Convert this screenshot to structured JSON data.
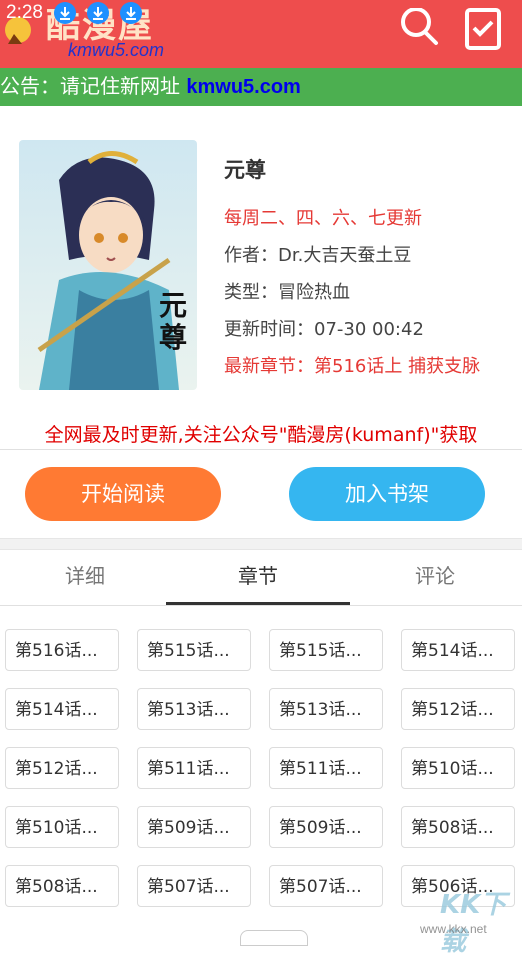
{
  "status": {
    "time": "2:28",
    "notifications": [
      "download-icon",
      "download-icon",
      "download-icon"
    ]
  },
  "header": {
    "logo_text": "酷漫屋",
    "logo_url": "kmwu5.com",
    "icons": [
      "search-icon",
      "bookshelf-icon"
    ]
  },
  "notice": {
    "prefix": "公告：请记住新网址 ",
    "url": "kmwu5.com"
  },
  "comic": {
    "title": "元尊",
    "schedule": "每周二、四、六、七更新",
    "author": "作者：Dr.大吉天蚕土豆",
    "genre": "类型：冒险热血",
    "updated": "更新时间：07-30 00:42",
    "latest": "最新章节：第516话上 捕获支脉",
    "cover_caption": "元尊"
  },
  "promo": "全网最及时更新,关注公众号\"酷漫房(kumanf)\"获取",
  "actions": {
    "read": "开始阅读",
    "shelf": "加入书架"
  },
  "tabs": [
    {
      "label": "详细"
    },
    {
      "label": "章节"
    },
    {
      "label": "评论"
    }
  ],
  "active_tab": "章节",
  "chapters": [
    "第516话...",
    "第515话...",
    "第515话...",
    "第514话...",
    "第514话...",
    "第513话...",
    "第513话...",
    "第512话...",
    "第512话...",
    "第511话...",
    "第511话...",
    "第510话...",
    "第510话...",
    "第509话...",
    "第509话...",
    "第508话...",
    "第508话...",
    "第507话...",
    "第507话...",
    "第506话..."
  ],
  "watermark": {
    "text": "KK下载",
    "url": "www.kkx.net"
  },
  "colors": {
    "header": "#ee4d4d",
    "notice": "#4caf50",
    "read_button": "#ff7a33",
    "shelf_button": "#35b6f0",
    "highlight": "#e53935"
  }
}
